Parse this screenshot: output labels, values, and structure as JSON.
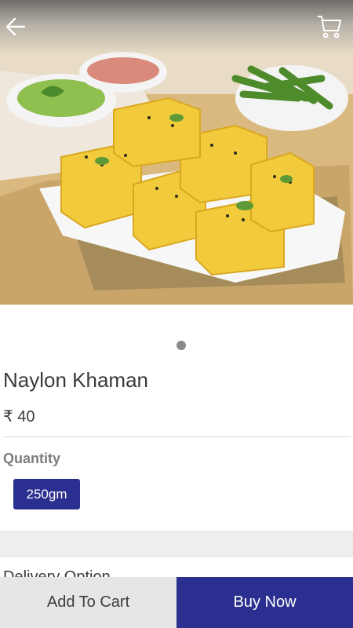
{
  "header": {
    "back_icon": "arrow-left-icon",
    "cart_icon": "cart-icon"
  },
  "product": {
    "name": "Naylon Khaman",
    "price": "₹ 40",
    "image_subject": "dhokla"
  },
  "carousel": {
    "current_page": 1,
    "total_pages": 1
  },
  "quantity": {
    "label": "Quantity",
    "options": [
      "250gm"
    ],
    "selected": "250gm"
  },
  "delivery": {
    "label": "Delivery Option"
  },
  "actions": {
    "add_to_cart": "Add To Cart",
    "buy_now": "Buy Now"
  },
  "colors": {
    "accent": "#2b2f8f",
    "secondary_button_bg": "#e4e6e8"
  }
}
